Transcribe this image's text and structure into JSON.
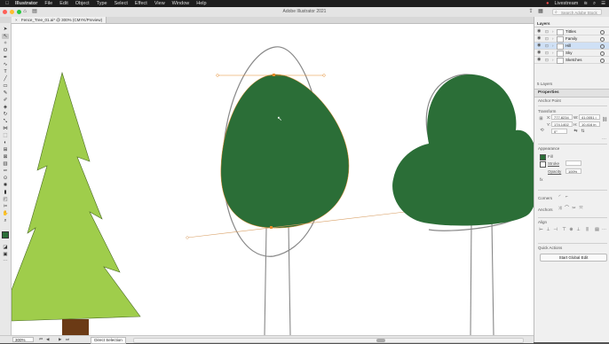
{
  "menubar": {
    "items": [
      "Illustrator",
      "File",
      "Edit",
      "Object",
      "Type",
      "Select",
      "Effect",
      "View",
      "Window",
      "Help"
    ],
    "right_label": "Livestream"
  },
  "window": {
    "title": "Adobe Illustrator 2021",
    "search_placeholder": "Search Adobe Stock",
    "traffic_colors": [
      "#fe5f57",
      "#febc2e",
      "#28c840"
    ]
  },
  "document": {
    "tab_label": "Fence_Tree_01.ai* @ 300% (CMYK/Preview)",
    "tab_close": "×"
  },
  "layers_panel": {
    "tabs": [
      "Layers"
    ],
    "layers": [
      {
        "name": "Tittles",
        "selected": false
      },
      {
        "name": "Family",
        "selected": false
      },
      {
        "name": "Hill",
        "selected": true
      },
      {
        "name": "Sky",
        "selected": false
      },
      {
        "name": "Sketches",
        "selected": false
      }
    ],
    "footer": "5 Layers"
  },
  "properties": {
    "title": "Properties",
    "selection": "Anchor Point",
    "transform_label": "Transform",
    "x_value": "777.8234",
    "y_value": "174.1402",
    "w_value": "41.0051 i",
    "h_value": "10.416 in",
    "angle_value": "0°",
    "appearance_label": "Appearance",
    "fill_label": "Fill",
    "stroke_label": "Stroke",
    "opacity_label": "Opacity",
    "opacity_value": "100%",
    "fx_label": "fx",
    "corners_label": "Corners",
    "anchors_label": "Anchors",
    "align_label": "Align",
    "quick_actions_label": "Quick Actions",
    "quick_action_button": "Start Global Edit"
  },
  "status": {
    "zoom": "300%",
    "status_text": "Direct Selection"
  },
  "colors": {
    "tree_light_green": "#9fcd4b",
    "tree_dark_green": "#2b6e37",
    "trunk_brown": "#6b3a15",
    "canvas": "#ffffff",
    "selection_orange": "#e58a2a"
  }
}
